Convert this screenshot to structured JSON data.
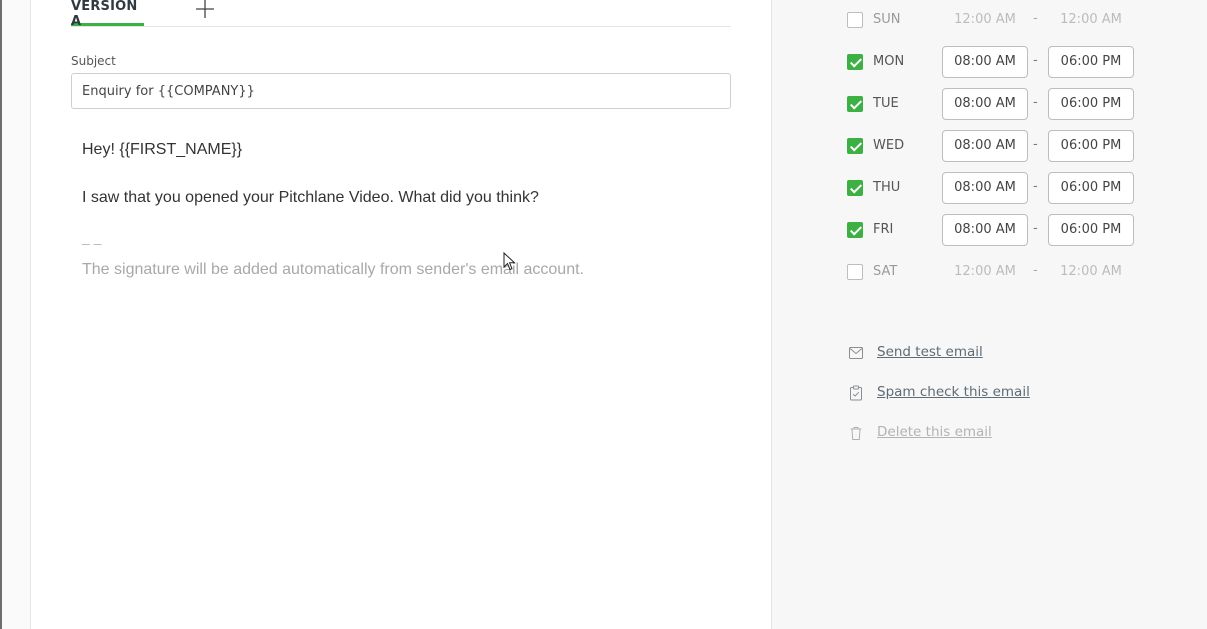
{
  "editor": {
    "tabs": [
      {
        "label": "VERSION A"
      }
    ],
    "subject": {
      "label": "Subject",
      "value": "Enquiry for {{COMPANY}}"
    },
    "body": {
      "greeting": "Hey! {{FIRST_NAME}}",
      "message": "I saw that you opened your Pitchlane Video. What did you think?",
      "signature_separator": "_ _",
      "signature_note": "The signature will be added automatically from sender's email account."
    }
  },
  "schedule": {
    "days": [
      {
        "label": "SUN",
        "checked": false,
        "start": "12:00 AM",
        "end": "12:00 AM"
      },
      {
        "label": "MON",
        "checked": true,
        "start": "08:00 AM",
        "end": "06:00 PM"
      },
      {
        "label": "TUE",
        "checked": true,
        "start": "08:00 AM",
        "end": "06:00 PM"
      },
      {
        "label": "WED",
        "checked": true,
        "start": "08:00 AM",
        "end": "06:00 PM"
      },
      {
        "label": "THU",
        "checked": true,
        "start": "08:00 AM",
        "end": "06:00 PM"
      },
      {
        "label": "FRI",
        "checked": true,
        "start": "08:00 AM",
        "end": "06:00 PM"
      },
      {
        "label": "SAT",
        "checked": false,
        "start": "12:00 AM",
        "end": "12:00 AM"
      }
    ],
    "separator": "-"
  },
  "actions": {
    "send_test": {
      "label": "Send test email",
      "icon": "mail-icon"
    },
    "spam_check": {
      "label": "Spam check this email",
      "icon": "clipboard-check-icon"
    },
    "delete": {
      "label": "Delete this email",
      "icon": "trash-icon",
      "disabled": true
    }
  },
  "colors": {
    "accent": "#3cb043",
    "link": "#5f6b75",
    "disabled": "#b3b3b3"
  }
}
